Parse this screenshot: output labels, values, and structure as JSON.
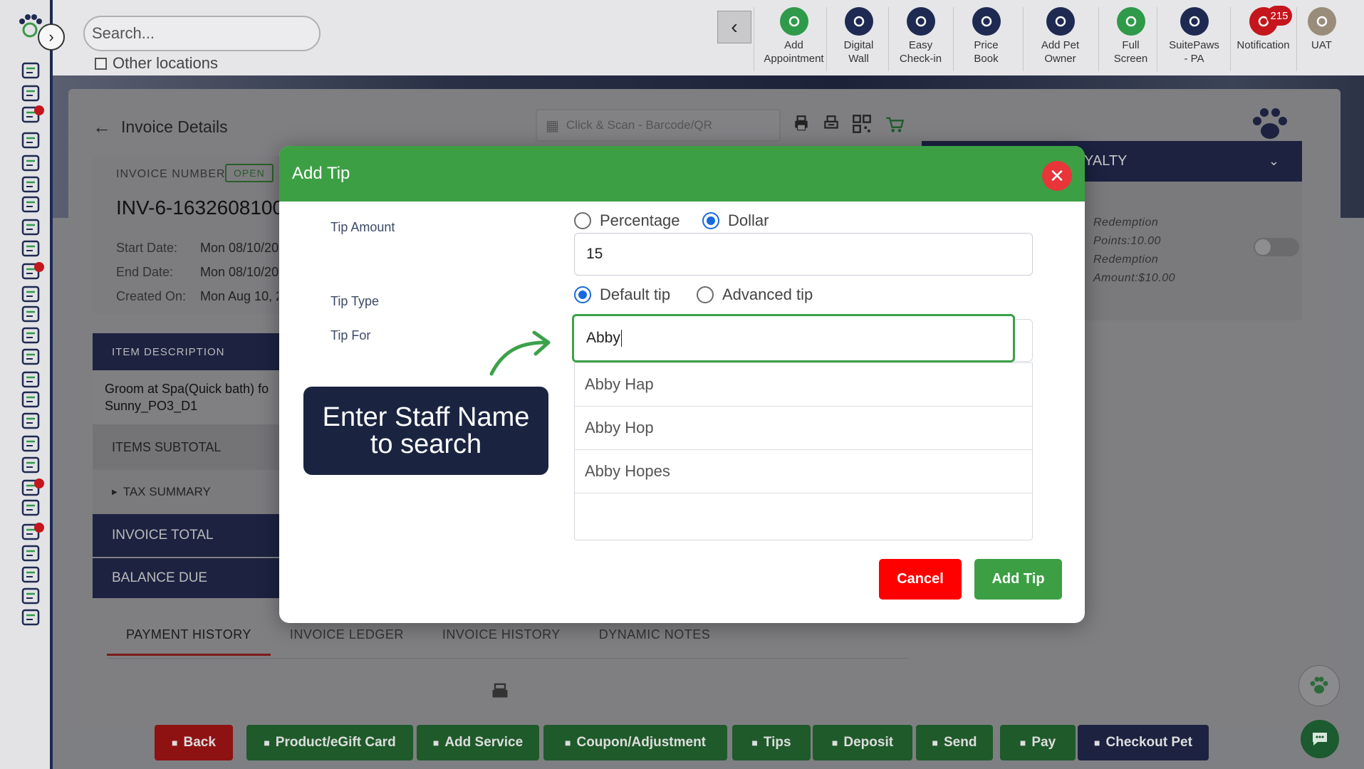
{
  "topbar": {
    "search_placeholder": "Search...",
    "other_locations": "Other locations",
    "buttons": [
      {
        "label": "Add\nAppointment",
        "l1": "Add",
        "l2": "Appointment",
        "icon": "calendar-plus-icon",
        "color": "#2e9a4a"
      },
      {
        "label": "Digital Wall",
        "l1": "Digital",
        "l2": "Wall",
        "icon": "monitor-icon",
        "color": "#1e2a52"
      },
      {
        "label": "Easy Check-in",
        "l1": "Easy",
        "l2": "Check-in",
        "icon": "paw-icon",
        "color": "#1e2a52"
      },
      {
        "label": "Price Book",
        "l1": "Price",
        "l2": "Book",
        "icon": "book-icon",
        "color": "#1e2a52"
      },
      {
        "label": "Add Pet Owner",
        "l1": "Add Pet",
        "l2": "Owner",
        "icon": "user-plus-icon",
        "color": "#1e2a52"
      },
      {
        "label": "Full Screen",
        "l1": "Full",
        "l2": "Screen",
        "icon": "expand-icon",
        "color": "#2e9a4a"
      },
      {
        "label": "SuitePaws - PA",
        "l1": "SuitePaws",
        "l2": "- PA",
        "icon": "location-pin-icon",
        "color": "#1e2a52"
      },
      {
        "label": "Notification",
        "l1": "Notification",
        "l2": "",
        "icon": "bell-icon",
        "color": "#c4161c"
      },
      {
        "label": "UAT",
        "l1": "UAT",
        "l2": "",
        "icon": "avatar",
        "color": "#444"
      }
    ],
    "notification_count": "215"
  },
  "page": {
    "title": "Invoice Details",
    "scan_placeholder": "Click & Scan - Barcode/QR",
    "invoice_number_label": "INVOICE NUMBER",
    "status": "OPEN",
    "invoice_number": "INV-6-1632608100",
    "start_label": "Start Date:",
    "start_value": "Mon 08/10/20",
    "end_label": "End Date:",
    "end_value": "Mon 08/10/20",
    "created_label": "Created On:",
    "created_value": "Mon Aug 10, 2",
    "loyalty_title": "YALTY",
    "loyalty_line1": "Redemption",
    "loyalty_line2": "Points:10.00",
    "loyalty_line3": "Redemption",
    "loyalty_line4": "Amount:$10.00",
    "item_desc_header": "ITEM DESCRIPTION",
    "item_line1": "Groom at Spa(Quick bath) fo",
    "item_line2": "Sunny_PO3_D1",
    "items_subtotal": "ITEMS SUBTOTAL",
    "tax_summary": "TAX SUMMARY",
    "invoice_total": "INVOICE TOTAL",
    "balance_due": "BALANCE DUE",
    "tabs": [
      "PAYMENT HISTORY",
      "INVOICE LEDGER",
      "INVOICE HISTORY",
      "DYNAMIC NOTES"
    ]
  },
  "bottom_buttons": [
    {
      "label": "Back",
      "icon": "arrow-left-icon",
      "color": "#8f1212"
    },
    {
      "label": "Product/eGift Card",
      "icon": "gift-icon",
      "color": "#1f5a2a"
    },
    {
      "label": "Add Service",
      "icon": "service-bell-icon",
      "color": "#1f5a2a"
    },
    {
      "label": "Coupon/Adjustment",
      "icon": "tag-icon",
      "color": "#1f5a2a"
    },
    {
      "label": "Tips",
      "icon": "hand-coin-icon",
      "color": "#1f5a2a"
    },
    {
      "label": "Deposit",
      "icon": "piggy-bank-icon",
      "color": "#1f5a2a"
    },
    {
      "label": "Send",
      "icon": "paper-plane-icon",
      "color": "#1f5a2a"
    },
    {
      "label": "Pay",
      "icon": "credit-card-icon",
      "color": "#1f5a2a"
    },
    {
      "label": "Checkout Pet",
      "icon": "paw-icon",
      "color": "#1c2240"
    }
  ],
  "modal": {
    "title": "Add Tip",
    "tip_amount_label": "Tip Amount",
    "percentage_label": "Percentage",
    "dollar_label": "Dollar",
    "tip_amount_mode": "Dollar",
    "tip_amount_value": "15",
    "tip_type_label": "Tip Type",
    "default_tip_label": "Default tip",
    "advanced_tip_label": "Advanced tip",
    "tip_type_selected": "Default tip",
    "tip_for_label": "Tip For",
    "tip_for_value": "Abby",
    "suggestions": [
      "Abby Hap",
      "Abby Hop",
      "Abby Hopes"
    ],
    "callout": "Enter Staff Name to search",
    "cancel_label": "Cancel",
    "add_tip_label": "Add Tip"
  },
  "colors": {
    "modal_header": "#3c9f44",
    "close_button": "#e8353a",
    "cancel_button": "#ff0000",
    "add_button": "#3c9f44",
    "callout_bg": "#1a2440",
    "radio_selected": "#1769e0"
  }
}
